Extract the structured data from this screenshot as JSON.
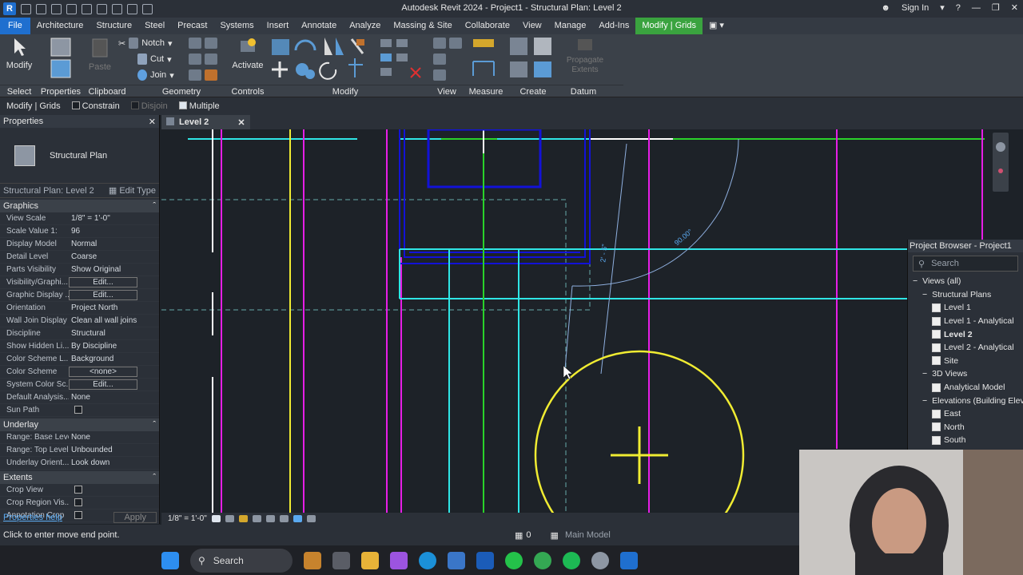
{
  "window": {
    "title": "Autodesk Revit 2024 - Project1 - Structural Plan: Level 2",
    "sign_in": "Sign In"
  },
  "menu_tabs": [
    "File",
    "Architecture",
    "Structure",
    "Steel",
    "Precast",
    "Systems",
    "Insert",
    "Annotate",
    "Analyze",
    "Massing & Site",
    "Collaborate",
    "View",
    "Manage",
    "Add-Ins",
    "Modify | Grids"
  ],
  "ribbon": {
    "modify_label": "Modify",
    "paste_label": "Paste",
    "notch_label": "Notch",
    "cut_label": "Cut",
    "join_label": "Join",
    "activate_label": "Activate",
    "propagate_label": "Propagate Extents",
    "groups": [
      "Select",
      "Properties",
      "Clipboard",
      "Geometry",
      "Controls",
      "Modify",
      "View",
      "Measure",
      "Create",
      "Datum"
    ]
  },
  "options_bar": {
    "context": "Modify | Grids",
    "constrain": "Constrain",
    "disjoin": "Disjoin",
    "multiple": "Multiple"
  },
  "properties": {
    "header": "Properties",
    "type_name": "Structural Plan",
    "instance": "Structural Plan: Level 2",
    "edit_type": "Edit Type",
    "sections": [
      {
        "name": "Graphics",
        "rows": [
          {
            "k": "View Scale",
            "v": "1/8\" = 1'-0\""
          },
          {
            "k": "Scale Value    1:",
            "v": "96"
          },
          {
            "k": "Display Model",
            "v": "Normal"
          },
          {
            "k": "Detail Level",
            "v": "Coarse"
          },
          {
            "k": "Parts Visibility",
            "v": "Show Original"
          },
          {
            "k": "Visibility/Graphi...",
            "v": "Edit...",
            "btn": true
          },
          {
            "k": "Graphic Display ...",
            "v": "Edit...",
            "btn": true
          },
          {
            "k": "Orientation",
            "v": "Project North"
          },
          {
            "k": "Wall Join Display",
            "v": "Clean all wall joins"
          },
          {
            "k": "Discipline",
            "v": "Structural"
          },
          {
            "k": "Show Hidden Li...",
            "v": "By Discipline"
          },
          {
            "k": "Color Scheme L...",
            "v": "Background"
          },
          {
            "k": "Color Scheme",
            "v": "<none>",
            "btn": true
          },
          {
            "k": "System Color Sc...",
            "v": "Edit...",
            "btn": true
          },
          {
            "k": "Default Analysis...",
            "v": "None"
          },
          {
            "k": "Sun Path",
            "v": ""
          }
        ]
      },
      {
        "name": "Underlay",
        "rows": [
          {
            "k": "Range: Base Level",
            "v": "None"
          },
          {
            "k": "Range: Top Level",
            "v": "Unbounded"
          },
          {
            "k": "Underlay Orient...",
            "v": "Look down"
          }
        ]
      },
      {
        "name": "Extents",
        "rows": [
          {
            "k": "Crop View",
            "v": ""
          },
          {
            "k": "Crop Region Vis...",
            "v": ""
          },
          {
            "k": "Annotation Crop",
            "v": ""
          }
        ]
      }
    ],
    "help": "Properties help",
    "apply": "Apply"
  },
  "view_tab": {
    "name": "Level 2"
  },
  "canvas": {
    "dim_angle": "90.00°",
    "dim_len": "2' - 5\""
  },
  "view_control": {
    "scale": "1/8\" = 1'-0\""
  },
  "status": {
    "message": "Click to enter move end point.",
    "worksets": "0",
    "model": "Main Model"
  },
  "project_browser": {
    "header": "Project Browser - Project1",
    "search_placeholder": "Search",
    "tree": [
      {
        "label": "Views (all)",
        "level": 0,
        "icon": false
      },
      {
        "label": "Structural Plans",
        "level": 1,
        "icon": false
      },
      {
        "label": "Level 1",
        "level": 2,
        "icon": true
      },
      {
        "label": "Level 1 - Analytical",
        "level": 2,
        "icon": true
      },
      {
        "label": "Level 2",
        "level": 2,
        "icon": true,
        "bold": true
      },
      {
        "label": "Level 2 - Analytical",
        "level": 2,
        "icon": true
      },
      {
        "label": "Site",
        "level": 2,
        "icon": true
      },
      {
        "label": "3D Views",
        "level": 1,
        "icon": false
      },
      {
        "label": "Analytical Model",
        "level": 2,
        "icon": true
      },
      {
        "label": "Elevations (Building Elevation)",
        "level": 1,
        "icon": false
      },
      {
        "label": "East",
        "level": 2,
        "icon": true
      },
      {
        "label": "North",
        "level": 2,
        "icon": true
      },
      {
        "label": "South",
        "level": 2,
        "icon": true
      }
    ]
  },
  "taskbar": {
    "search": "Search"
  },
  "colors": {
    "accent": "#3aa33f",
    "file": "#1f6fcf",
    "grid_magenta": "#e61ee6",
    "grid_yellow": "#f0ec32",
    "cyan": "#2fe6e6",
    "blue": "#1212d8",
    "green": "#2ad22a"
  }
}
